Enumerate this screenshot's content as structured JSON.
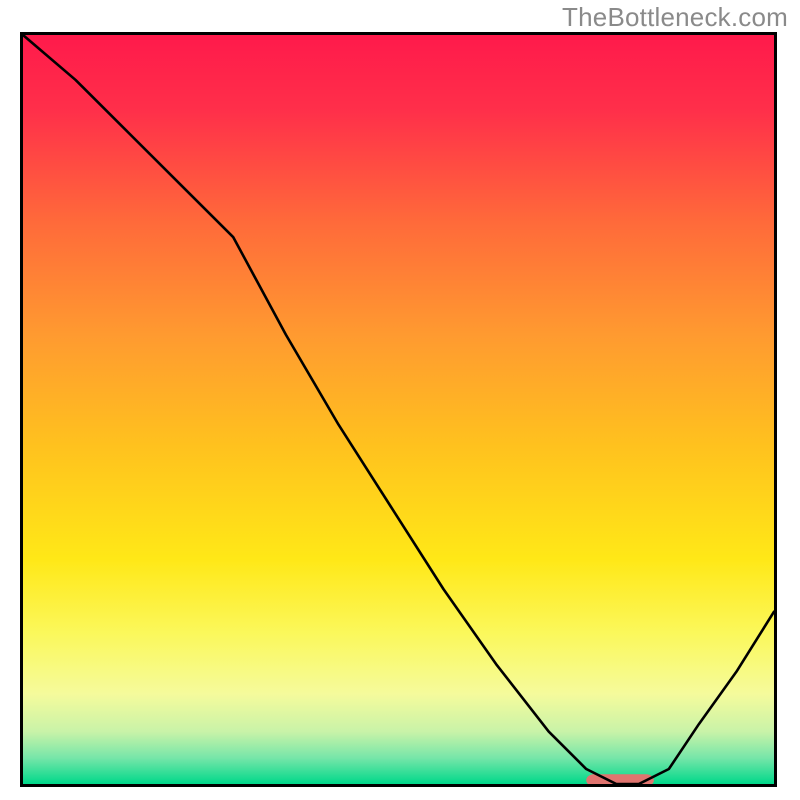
{
  "watermark": {
    "text": "TheBottleneck.com"
  },
  "chart_data": {
    "type": "line",
    "title": "",
    "xlabel": "",
    "ylabel": "",
    "xlim": [
      0,
      100
    ],
    "ylim": [
      0,
      100
    ],
    "grid": false,
    "legend": false,
    "background": {
      "type": "vertical_gradient",
      "stops": [
        {
          "pos": 0.0,
          "color": "#ff1a4b"
        },
        {
          "pos": 0.1,
          "color": "#ff2f4a"
        },
        {
          "pos": 0.25,
          "color": "#ff6a3a"
        },
        {
          "pos": 0.4,
          "color": "#ff9a30"
        },
        {
          "pos": 0.55,
          "color": "#ffc21e"
        },
        {
          "pos": 0.7,
          "color": "#ffe817"
        },
        {
          "pos": 0.8,
          "color": "#fbf85c"
        },
        {
          "pos": 0.88,
          "color": "#f5fb9c"
        },
        {
          "pos": 0.93,
          "color": "#c9f3a8"
        },
        {
          "pos": 0.965,
          "color": "#77e6a9"
        },
        {
          "pos": 1.0,
          "color": "#00d88a"
        }
      ]
    },
    "series": [
      {
        "name": "bottleneck-curve",
        "stroke": "#000000",
        "stroke_width": 2.6,
        "x": [
          0,
          7,
          14,
          21,
          28,
          35,
          42,
          49,
          56,
          63,
          70,
          75,
          79,
          82,
          86,
          90,
          95,
          100
        ],
        "y": [
          100,
          94,
          87,
          80,
          73,
          60,
          48,
          37,
          26,
          16,
          7,
          2,
          0,
          0,
          2,
          8,
          15,
          23
        ]
      }
    ],
    "marker": {
      "name": "optimal-range",
      "shape": "rounded_bar",
      "color": "#e0746f",
      "x_start": 75,
      "x_end": 84,
      "y": 0.5,
      "height": 1.6
    }
  }
}
